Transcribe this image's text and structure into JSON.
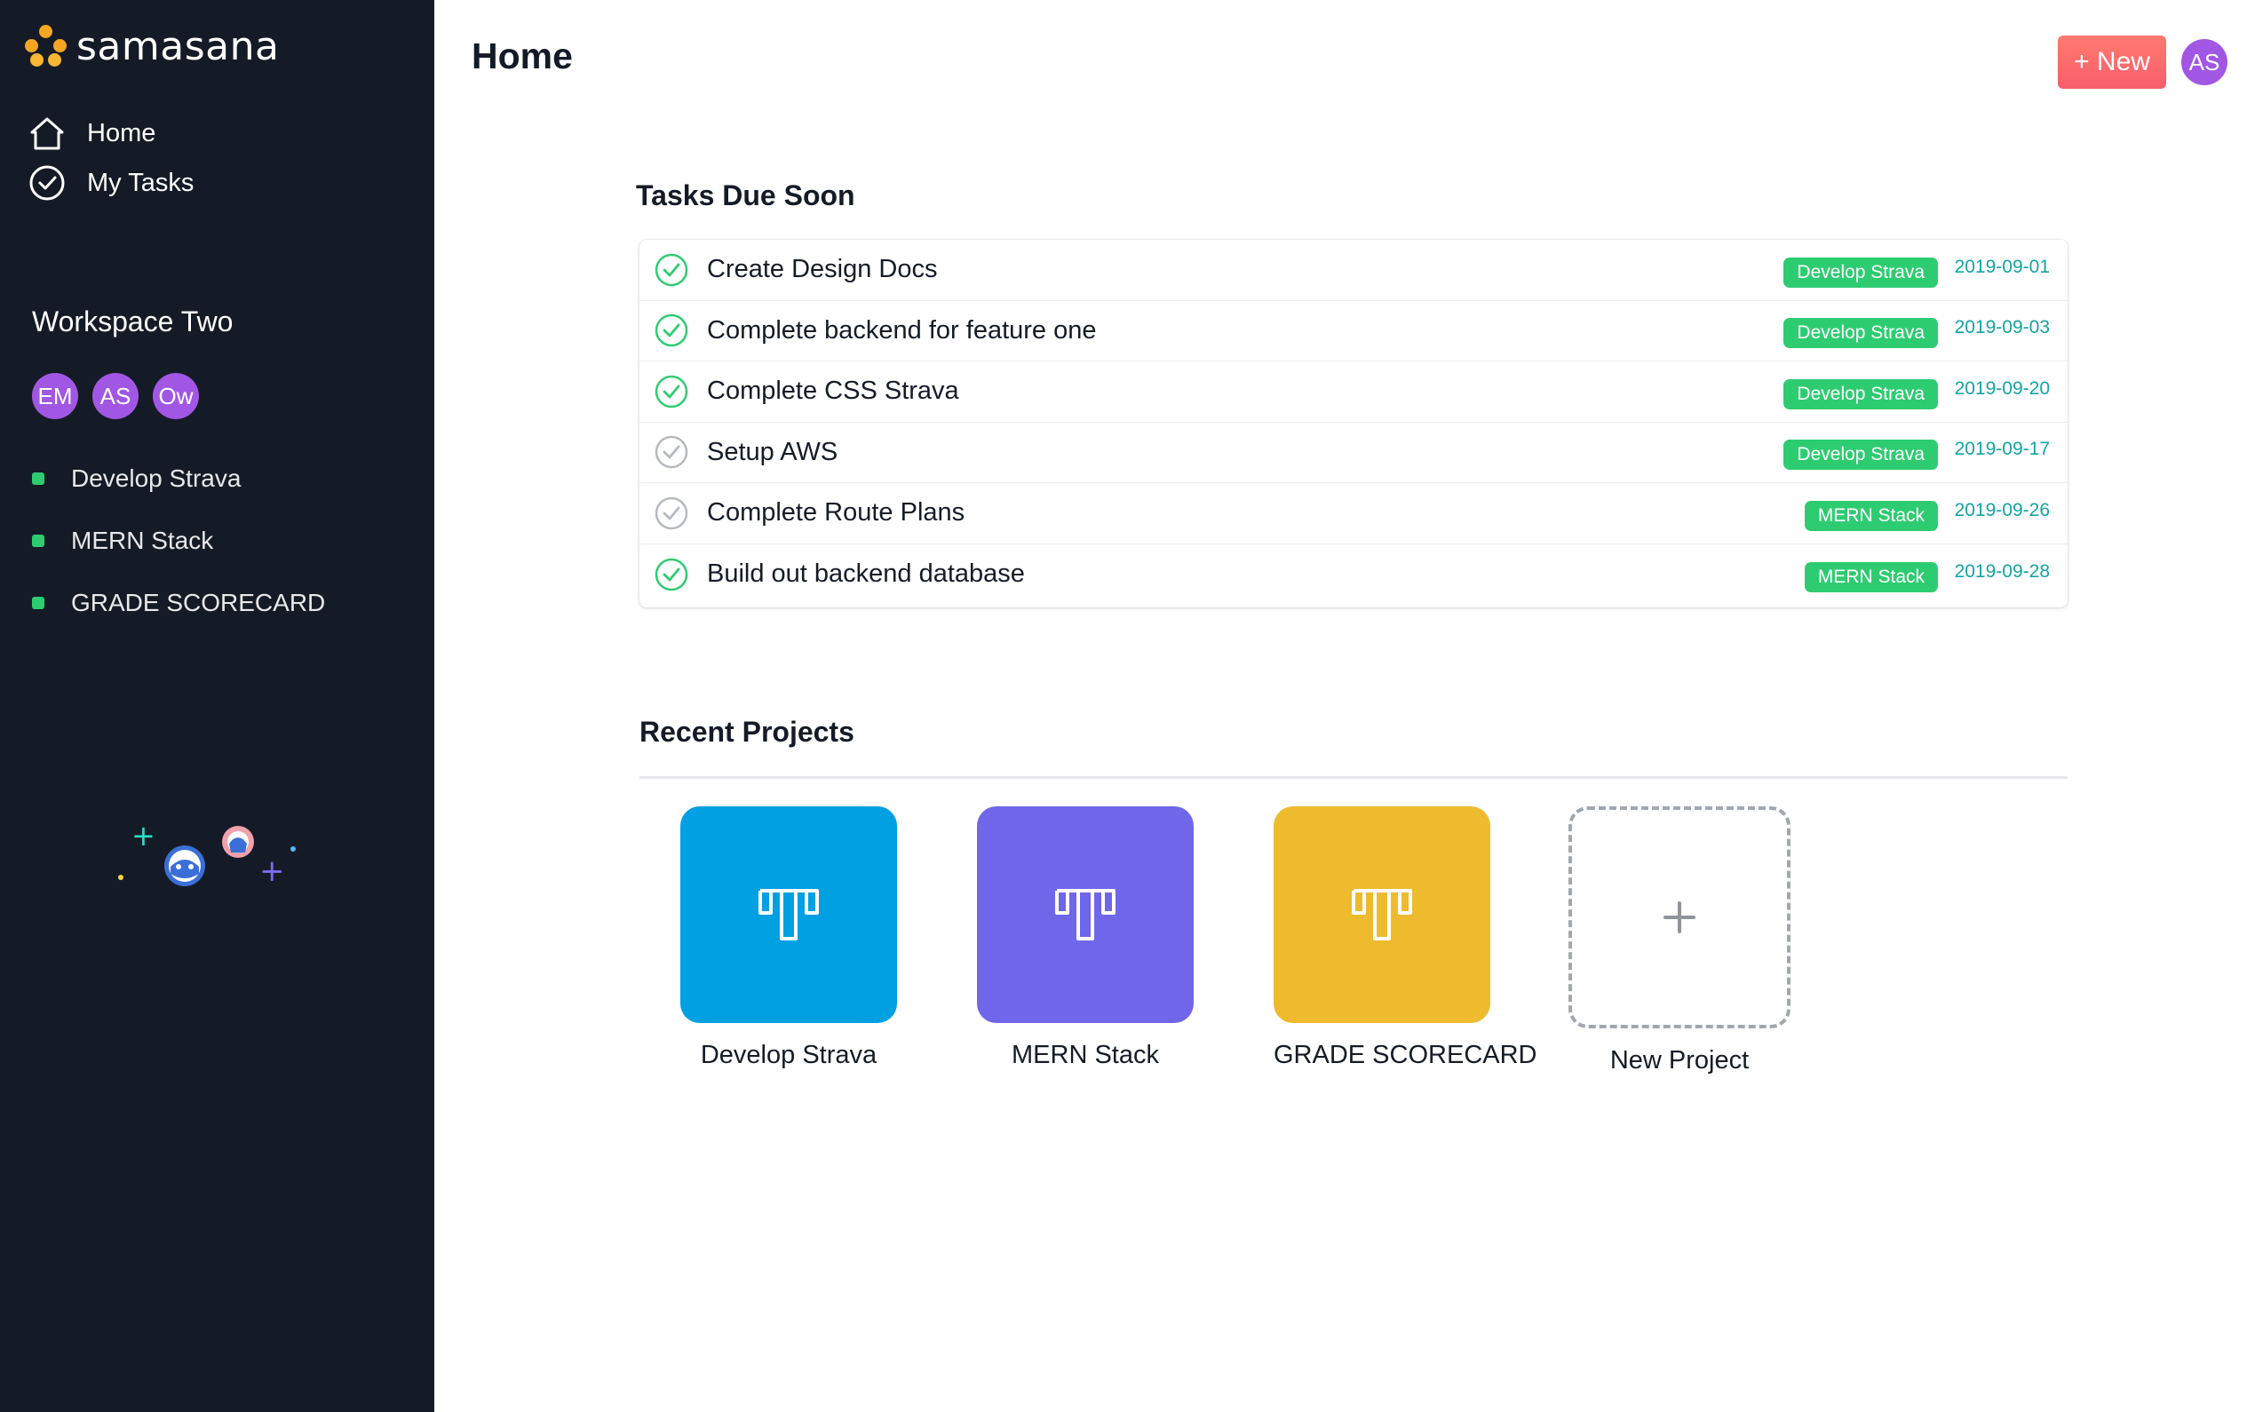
{
  "app": {
    "logo_text": "samasana",
    "logo_color": "#f5a623"
  },
  "sidebar": {
    "background": "#151b26",
    "nav": [
      {
        "label": "Home",
        "icon": "home-icon"
      },
      {
        "label": "My Tasks",
        "icon": "check-circle-icon"
      }
    ],
    "workspace": {
      "title": "Workspace Two",
      "members": [
        "EM",
        "AS",
        "Ow"
      ],
      "member_color": "#a156e4"
    },
    "projects": [
      {
        "label": "Develop Strava",
        "dot_color": "#2ecc71"
      },
      {
        "label": "MERN Stack",
        "dot_color": "#2ecc71"
      },
      {
        "label": "GRADE SCORECARD",
        "dot_color": "#2ecc71"
      }
    ],
    "illustration": "team-avatars-illustration"
  },
  "header": {
    "title": "Home",
    "new_button": "+ New",
    "user_initials": "AS"
  },
  "tasks": {
    "title": "Tasks Due Soon",
    "rows": [
      {
        "name": "Create Design Docs",
        "project": "Develop Strava",
        "date": "2019-09-01",
        "completed": true
      },
      {
        "name": "Complete backend for feature one",
        "project": "Develop Strava",
        "date": "2019-09-03",
        "completed": true
      },
      {
        "name": "Complete CSS Strava",
        "project": "Develop Strava",
        "date": "2019-09-20",
        "completed": true
      },
      {
        "name": "Setup AWS",
        "project": "Develop Strava",
        "date": "2019-09-17",
        "completed": false
      },
      {
        "name": "Complete Route Plans",
        "project": "MERN Stack",
        "date": "2019-09-26",
        "completed": false
      },
      {
        "name": "Build out backend database",
        "project": "MERN Stack",
        "date": "2019-09-28",
        "completed": true
      }
    ]
  },
  "recent_projects": {
    "title": "Recent Projects",
    "tiles": [
      {
        "label": "Develop Strava",
        "color": "#00a0e2",
        "icon": "board-icon"
      },
      {
        "label": "MERN Stack",
        "color": "#6f66ea",
        "icon": "board-icon"
      },
      {
        "label": "GRADE SCORECARD",
        "color": "#edbb2d",
        "icon": "board-icon"
      }
    ],
    "new_project_label": "New Project"
  }
}
